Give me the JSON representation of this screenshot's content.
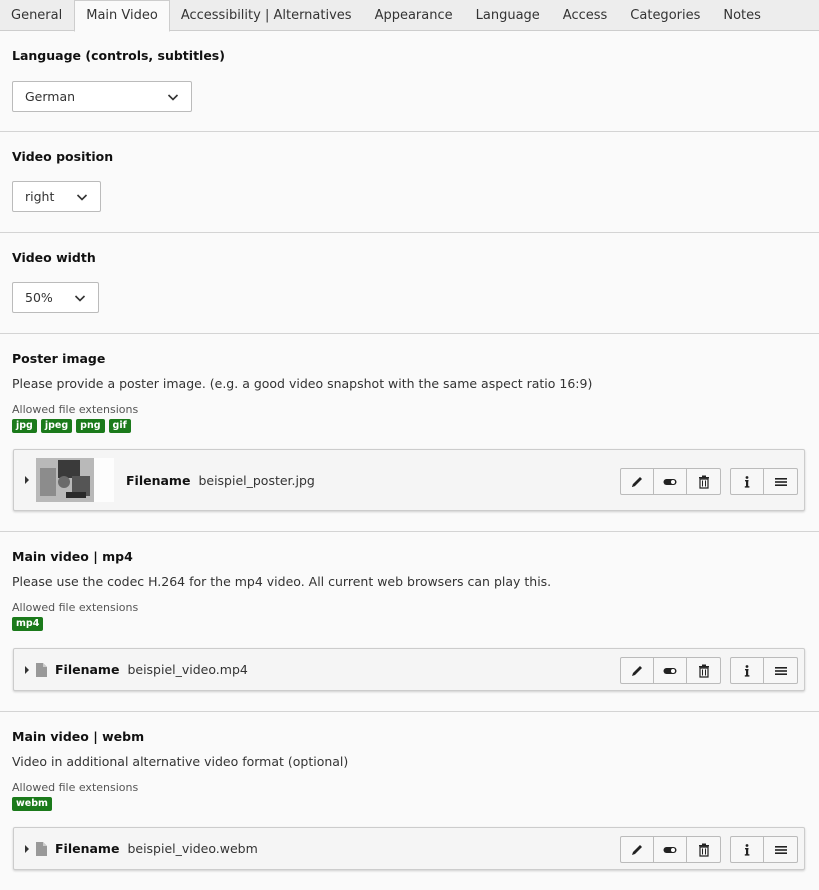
{
  "tabs": [
    {
      "label": "General"
    },
    {
      "label": "Main Video"
    },
    {
      "label": "Accessibility | Alternatives"
    },
    {
      "label": "Appearance"
    },
    {
      "label": "Language"
    },
    {
      "label": "Access"
    },
    {
      "label": "Categories"
    },
    {
      "label": "Notes"
    }
  ],
  "active_tab": "Main Video",
  "language": {
    "label": "Language (controls, subtitles)",
    "value": "German"
  },
  "position": {
    "label": "Video position",
    "value": "right"
  },
  "width": {
    "label": "Video width",
    "value": "50%"
  },
  "poster": {
    "label": "Poster image",
    "description": "Please provide a poster image. (e.g. a good video snapshot with the same aspect ratio 16:9)",
    "allowed_label": "Allowed file extensions",
    "extensions": [
      "jpg",
      "jpeg",
      "png",
      "gif"
    ],
    "file_label": "Filename",
    "file_name": "beispiel_poster.jpg"
  },
  "mp4": {
    "label": "Main video | mp4",
    "description": "Please use the codec H.264 for the mp4 video. All current web browsers can play this.",
    "allowed_label": "Allowed file extensions",
    "extensions": [
      "mp4"
    ],
    "file_label": "Filename",
    "file_name": "beispiel_video.mp4"
  },
  "webm": {
    "label": "Main video | webm",
    "description": "Video in additional alternative video format (optional)",
    "allowed_label": "Allowed file extensions",
    "extensions": [
      "webm"
    ],
    "file_label": "Filename",
    "file_name": "beispiel_video.webm"
  },
  "colors": {
    "extension_badge": "#1b7a1b",
    "tab_bar": "#ededed",
    "background": "#fafafa"
  },
  "icons": [
    "caret-right-icon",
    "file-icon",
    "pencil-icon",
    "toggle-icon",
    "trash-icon",
    "info-icon",
    "menu-icon",
    "chevron-down-icon"
  ]
}
